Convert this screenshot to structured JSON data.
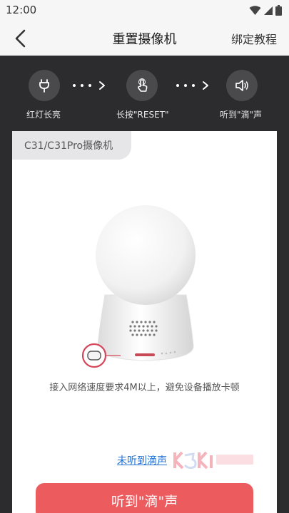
{
  "status_bar": {
    "time": "12:00",
    "icons": [
      "wifi-icon",
      "signal-icon",
      "battery-icon"
    ]
  },
  "navbar": {
    "back_icon": "chevron-left-icon",
    "title": "重置摄像机",
    "action": "绑定教程"
  },
  "steps": [
    {
      "icon": "plug-icon",
      "label": "红灯长亮"
    },
    {
      "icon": "press-finger-icon",
      "label": "长按\"RESET\""
    },
    {
      "icon": "speaker-icon",
      "label": "听到\"滴\"声"
    }
  ],
  "card": {
    "model_tag": "C31/C31Pro摄像机",
    "hint": "接入网络速度要求4M以上，避免设备播放卡顿",
    "link": "未听到滴声",
    "button": "听到\"滴\"声"
  },
  "colors": {
    "accent": "#ec5b5e",
    "link": "#1f6fd6",
    "dark_bg": "#2c2c2e"
  }
}
